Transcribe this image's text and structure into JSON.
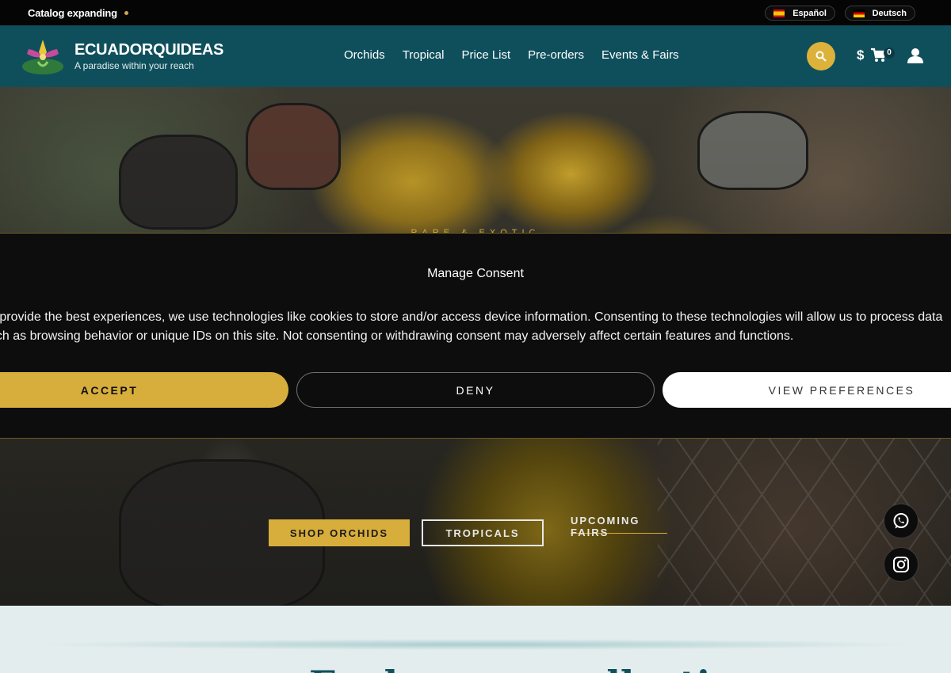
{
  "topbar": {
    "announcement": "Catalog expanding",
    "languages": [
      {
        "label": "Español",
        "flag": "spain-flag-icon"
      },
      {
        "label": "Deutsch",
        "flag": "germany-flag-icon"
      }
    ]
  },
  "header": {
    "brand": "ECUADORQUIDEAS",
    "tagline": "A paradise within your reach",
    "nav": [
      "Orchids",
      "Tropical",
      "Price List",
      "Pre-orders",
      "Events & Fairs"
    ],
    "currency": "$",
    "cart_count": "0"
  },
  "hero": {
    "eyebrow": "RARE & EXOTIC",
    "buttons": {
      "shop": "SHOP ORCHIDS",
      "tropicals": "TROPICALS",
      "fairs": "UPCOMING FAIRS"
    }
  },
  "consent": {
    "title": "Manage Consent",
    "text": "To provide the best experiences, we use technologies like cookies to store and/or access device information. Consenting to these technologies will allow us to process data such as browsing behavior or unique IDs on this site. Not consenting or withdrawing consent may adversely affect certain features and functions.",
    "accept": "ACCEPT",
    "deny": "DENY",
    "preferences": "VIEW PREFERENCES"
  },
  "below": {
    "heading": "Explore our collection"
  },
  "colors": {
    "brand_teal": "#0f4f5c",
    "accent_gold": "#d7ad3c",
    "topbar_black": "#050505"
  }
}
